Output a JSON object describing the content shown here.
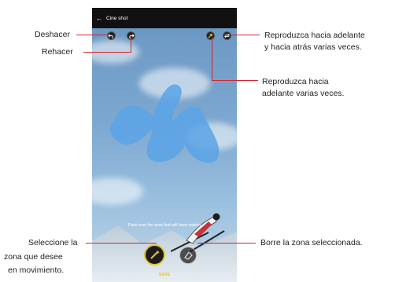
{
  "app": {
    "title": "Cine shot",
    "back_icon": "arrow-left-icon"
  },
  "canvas": {
    "hint": "Paint over the area that will have motion",
    "save_label": "SAVE"
  },
  "toolbar": {
    "undo_icon": "undo-icon",
    "redo_icon": "redo-icon",
    "forward_icon": "forward-loop-icon",
    "loop_icon": "bounce-loop-icon"
  },
  "callouts": {
    "undo": "Deshacer",
    "redo": "Rehacer",
    "loop_1": "Reproduzca hacia adelante",
    "loop_2": "y hacia atrás varias veces.",
    "forward_1": "Reproduzca hacia",
    "forward_2": "adelante varias veces.",
    "brush_1": "Seleccione la",
    "brush_2": "zona que desee",
    "brush_3": "en movimiento.",
    "eraser": "Borre la zona seleccionada."
  },
  "colors": {
    "accent": "#e9c232",
    "callout_line": "#d6242a",
    "paint": "#5aa3e6"
  }
}
